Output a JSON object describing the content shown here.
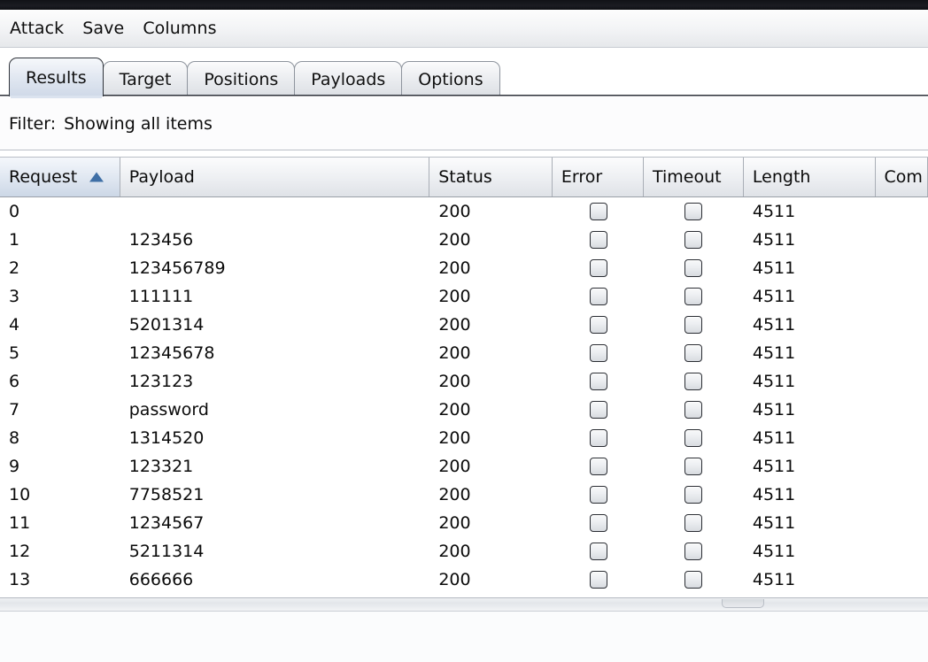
{
  "window": {
    "titlebar_color": "#15161b"
  },
  "menubar": {
    "items": [
      {
        "label": "Attack",
        "name": "menu-attack"
      },
      {
        "label": "Save",
        "name": "menu-save"
      },
      {
        "label": "Columns",
        "name": "menu-columns"
      }
    ]
  },
  "tabs": {
    "selected": "Results",
    "items": [
      {
        "label": "Results"
      },
      {
        "label": "Target"
      },
      {
        "label": "Positions"
      },
      {
        "label": "Payloads"
      },
      {
        "label": "Options"
      }
    ]
  },
  "filter": {
    "label": "Filter:",
    "value": "Showing all items"
  },
  "table": {
    "sort_column": "Request",
    "sort_direction": "ascending",
    "sort_icon": "sort-ascending-triangle-icon",
    "columns": [
      {
        "label": "Request",
        "key": "request"
      },
      {
        "label": "Payload",
        "key": "payload"
      },
      {
        "label": "Status",
        "key": "status"
      },
      {
        "label": "Error",
        "key": "error"
      },
      {
        "label": "Timeout",
        "key": "timeout"
      },
      {
        "label": "Length",
        "key": "length"
      },
      {
        "label": "Com",
        "key": "comment"
      }
    ],
    "rows": [
      {
        "request": "0",
        "payload": "",
        "status": "200",
        "error": false,
        "timeout": false,
        "length": "4511",
        "comment": ""
      },
      {
        "request": "1",
        "payload": "123456",
        "status": "200",
        "error": false,
        "timeout": false,
        "length": "4511",
        "comment": ""
      },
      {
        "request": "2",
        "payload": "123456789",
        "status": "200",
        "error": false,
        "timeout": false,
        "length": "4511",
        "comment": ""
      },
      {
        "request": "3",
        "payload": "111111",
        "status": "200",
        "error": false,
        "timeout": false,
        "length": "4511",
        "comment": ""
      },
      {
        "request": "4",
        "payload": "5201314",
        "status": "200",
        "error": false,
        "timeout": false,
        "length": "4511",
        "comment": ""
      },
      {
        "request": "5",
        "payload": "12345678",
        "status": "200",
        "error": false,
        "timeout": false,
        "length": "4511",
        "comment": ""
      },
      {
        "request": "6",
        "payload": "123123",
        "status": "200",
        "error": false,
        "timeout": false,
        "length": "4511",
        "comment": ""
      },
      {
        "request": "7",
        "payload": "password",
        "status": "200",
        "error": false,
        "timeout": false,
        "length": "4511",
        "comment": ""
      },
      {
        "request": "8",
        "payload": "1314520",
        "status": "200",
        "error": false,
        "timeout": false,
        "length": "4511",
        "comment": ""
      },
      {
        "request": "9",
        "payload": "123321",
        "status": "200",
        "error": false,
        "timeout": false,
        "length": "4511",
        "comment": ""
      },
      {
        "request": "10",
        "payload": "7758521",
        "status": "200",
        "error": false,
        "timeout": false,
        "length": "4511",
        "comment": ""
      },
      {
        "request": "11",
        "payload": "1234567",
        "status": "200",
        "error": false,
        "timeout": false,
        "length": "4511",
        "comment": ""
      },
      {
        "request": "12",
        "payload": "5211314",
        "status": "200",
        "error": false,
        "timeout": false,
        "length": "4511",
        "comment": ""
      },
      {
        "request": "13",
        "payload": "666666",
        "status": "200",
        "error": false,
        "timeout": false,
        "length": "4511",
        "comment": ""
      }
    ]
  },
  "splitter": {
    "grip_name": "splitter-grip"
  }
}
